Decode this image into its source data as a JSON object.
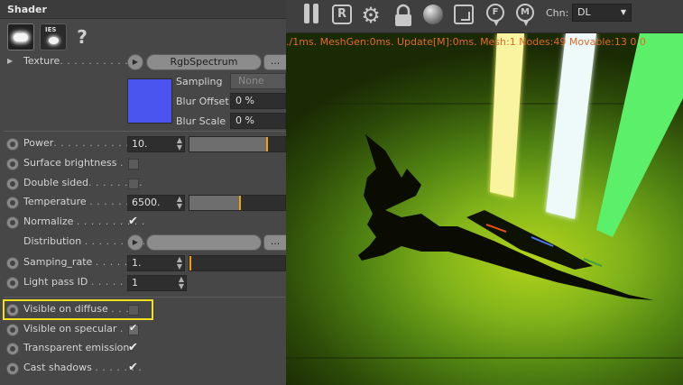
{
  "panel": {
    "title": "Shader",
    "mode_buttons": [
      {
        "name": "light-shader-icon"
      },
      {
        "name": "ies-shader-icon",
        "text": "IES"
      }
    ],
    "help_label": "?",
    "texture": {
      "label": "Texture",
      "dots": ". . . . . . . . . . . . .",
      "button": "RgbSpectrum",
      "more": "..."
    },
    "swatch_color": "#4a55f0",
    "sampling": {
      "label": "Sampling",
      "value": "None"
    },
    "blur_offset": {
      "label": "Blur Offset",
      "value": "0 %"
    },
    "blur_scale": {
      "label": "Blur Scale",
      "value": "0 %"
    },
    "power": {
      "label": "Power",
      "dots": ". . . . . . . . . . . . .",
      "value": "10.",
      "slider_fraction": 0.8
    },
    "surface_brightness": {
      "label": "Surface brightness",
      "dots": ". ."
    },
    "double_sided": {
      "label": "Double sided",
      "dots": ". . . . . . . ."
    },
    "temperature": {
      "label": "Temperature",
      "dots": ". . . . . . .",
      "value": "6500.",
      "slider_fraction": 0.52
    },
    "normalize": {
      "label": "Normalize",
      "dots": ". . . . . . . . . ."
    },
    "distribution": {
      "label": "Distribution",
      "dots": ". . . . . . . . .",
      "more": "..."
    },
    "samping_rate": {
      "label": "Samping_rate",
      "dots": ". . . . . . .",
      "value": "1.",
      "slider_fraction": 0.0
    },
    "light_pass_id": {
      "label": "Light pass ID",
      "dots": ". . . . . . .",
      "value": "1"
    },
    "visible_on_diffuse": {
      "label": "Visible on diffuse",
      "dots": ". . ."
    },
    "visible_on_specular": {
      "label": "Visible on specular",
      "dots": ". ."
    },
    "transparent_emission": {
      "label": "Transparent emission"
    },
    "cast_shadows": {
      "label": "Cast shadows",
      "dots": ". . . . . . ."
    },
    "check_glyph": "✔"
  },
  "toolbar": {
    "icons": [
      "pause-icon",
      "render-region-icon",
      "settings-gear-icon",
      "lock-icon",
      "material-sphere-icon",
      "region-frame-icon",
      "focus-pin-icon",
      "material-pin-icon"
    ],
    "render_letter": "R",
    "focus_letter": "F",
    "material_letter": "M",
    "chn_label": "Chn:",
    "chn_value": "DL"
  },
  "viewport": {
    "stats_text": "./1ms. MeshGen:0ms. Update[M]:0ms. Mesh:1 Nodes:49 Movable:13  0  0",
    "background": "#7fb21a",
    "light_colors": [
      "#f6f06c",
      "#f2fcfc",
      "#5cf06a"
    ]
  }
}
